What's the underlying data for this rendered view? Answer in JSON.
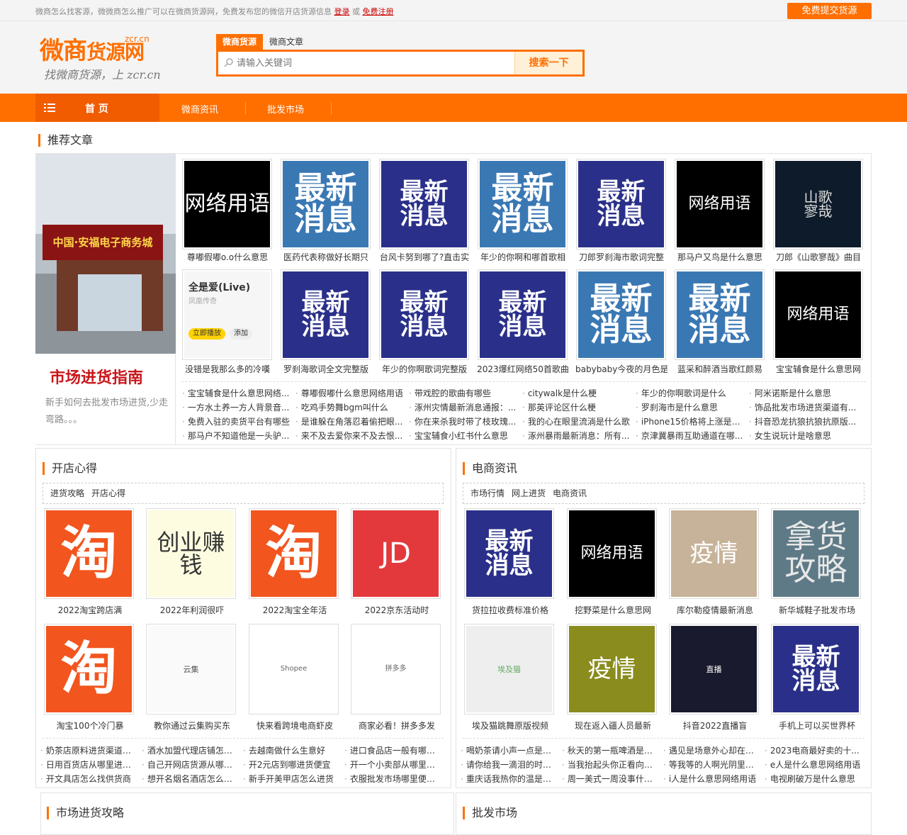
{
  "topbar": {
    "notice": "微商怎么找客源，微微商怎么推广可以在微商货源网，免费发布您的微信开店货源信息",
    "login": "登录",
    "or": "或",
    "register": "免费注册",
    "submit_button": "免费提交货源"
  },
  "logo": {
    "main": "微商",
    "main2": "货源网",
    "domain": "zcr.cn",
    "slogan": "找微商货源，上 zcr.cn"
  },
  "search": {
    "tabs": [
      "微商货源",
      "微商文章"
    ],
    "placeholder": "请输入关键词",
    "button": "搜索一下"
  },
  "nav": {
    "home": "首 页",
    "items": [
      "微商资讯",
      "批发市场"
    ]
  },
  "recommend": {
    "title": "推荐文章",
    "banner_title": "市场进货指南",
    "banner_sub": "新手如何去批发市场进货,少走弯路。。。",
    "banner_sign": "中国·安福电子商务城",
    "row1": [
      {
        "img": "网络用语",
        "caption": "尊嘟假嘟o.o什么意思"
      },
      {
        "img": "最新消息",
        "caption": "医药代表称做好长期只"
      },
      {
        "img": "最新消息",
        "caption": "台风卡努到哪了?直击实"
      },
      {
        "img": "最新消息",
        "caption": "年少的你啊和哪首歌相"
      },
      {
        "img": "最新消息",
        "caption": "刀郎罗刹海市歌词完整"
      },
      {
        "img": "网络用语",
        "caption": "那马户又鸟是什么意思"
      },
      {
        "img": "山歌寥哉",
        "caption": "刀郎《山歌寥哉》曲目"
      }
    ],
    "row2": [
      {
        "img": "全是爱(Live)",
        "caption": "没错是我那么多的冷嘆"
      },
      {
        "img": "最新消息",
        "caption": "罗刹海歌词全文完整版"
      },
      {
        "img": "最新消息",
        "caption": "年少的你啊歌词完整版"
      },
      {
        "img": "最新消息",
        "caption": "2023爆红网络50首歌曲"
      },
      {
        "img": "最新消息",
        "caption": "babybaby今夜的月色是"
      },
      {
        "img": "最新消息",
        "caption": "蓝采和醉酒当歌红颜易"
      },
      {
        "img": "网络用语",
        "caption": "宝宝辅食是什么意思网"
      }
    ],
    "app_card": {
      "title": "全是爱(Live)",
      "artist": "凤凰传奇",
      "play": "立即播放",
      "add": "添加"
    },
    "links": [
      [
        "宝宝辅食是什么意思网络...",
        "尊嘟假嘟什么意思网络用语",
        "带戏腔的歌曲有哪些",
        "citywalk是什么梗",
        "年少的你啊歌词是什么",
        "阿米诺斯是什么意思"
      ],
      [
        "一方水土养一方人背景音...",
        "吃鸡手势舞bgm叫什么",
        "涿州灾情最新消息通报：...",
        "那英评论区什么梗",
        "罗刹海市是什么意思",
        "饰品批发市场进货渠道有..."
      ],
      [
        "免费入驻的卖货平台有哪些",
        "是谁躲在角落忍着偷把眼...",
        "你在来杀我时带了枝玫瑰...",
        "我的心在眼里流淌是什么歌",
        "iPhone15价格将上涨是真...",
        "抖音恐龙抗狼抗狼抗原版..."
      ],
      [
        "那马户不知道他是一头驴...",
        "来不及去爱你来不及去恨...",
        "宝宝辅食小红书什么意思",
        "涿州暴雨最新消息：所有...",
        "京津冀暴雨互助通道在哪...",
        "女生说玩计是啥意思"
      ]
    ]
  },
  "kaidian": {
    "title": "开店心得",
    "tabs": [
      "进货攻略",
      "开店心得"
    ],
    "items": [
      {
        "img": "淘",
        "caption": "2022淘宝跨店满"
      },
      {
        "img": "创业赚钱",
        "caption": "2022年利润很吓"
      },
      {
        "img": "淘",
        "caption": "2022淘宝全年活"
      },
      {
        "img": "JD",
        "caption": "2022京东活动时"
      },
      {
        "img": "淘",
        "caption": "淘宝100个冷门暴"
      },
      {
        "img": "云集",
        "caption": "教你通过云集购买东"
      },
      {
        "img": "Shopee",
        "caption": "快来看跨境电商虾皮"
      },
      {
        "img": "拼多多",
        "caption": "商家必看！拼多多发"
      }
    ],
    "links": [
      [
        "奶茶店原料进货渠道有...",
        "酒水加盟代理店铺怎么...",
        "去越南做什么生意好",
        "进口食品店一般有哪些..."
      ],
      [
        "日用百货店从哪里进货...",
        "自己开网店货源从哪里来",
        "开2元店到哪进货便宜",
        "开一个小卖部从哪里进..."
      ],
      [
        "开文具店怎么找供货商",
        "想开名烟名酒店怎么入手",
        "新手开美甲店怎么进货",
        "衣服批发市场哪里便宜..."
      ]
    ]
  },
  "dianshang": {
    "title": "电商资讯",
    "tabs": [
      "市场行情",
      "网上进货",
      "电商资讯"
    ],
    "items": [
      {
        "img": "最新消息",
        "caption": "货拉拉收费标准价格"
      },
      {
        "img": "网络用语",
        "caption": "挖野菜是什么意思网"
      },
      {
        "img": "疫情",
        "caption": "库尔勒疫情最新消息"
      },
      {
        "img": "拿货攻略",
        "caption": "新华城鞋子批发市场"
      },
      {
        "img": "埃及猫",
        "caption": "埃及猫跳舞原版视频"
      },
      {
        "img": "疫情",
        "caption": "现在返入疆人员最新"
      },
      {
        "img": "直播",
        "caption": "抖音2022直播盲"
      },
      {
        "img": "最新消息",
        "caption": "手机上可以买世界杯"
      }
    ],
    "links": [
      [
        "喝奶茶请小声一点是什...",
        "秋天的第一瓶啤酒是什...",
        "遇见是场意外心却在风...",
        "2023电商最好卖的十..."
      ],
      [
        "请你给我一滴泪的时间...",
        "当我抬起头你正看向我...",
        "等我等的人啊光阴里的...",
        "e人是什么意思网络用语"
      ],
      [
        "重庆话我热你的温是什...",
        "周一美式一周没事什么...",
        "i人是什么意思网络用语",
        "电视刷破万是什么意思"
      ]
    ]
  },
  "bottom": {
    "left_title": "市场进货攻略",
    "right_title": "批发市场"
  },
  "colors": {
    "brand": "#ff6f00",
    "news_bg": "#2a3089",
    "accent_red": "#c9161b"
  }
}
